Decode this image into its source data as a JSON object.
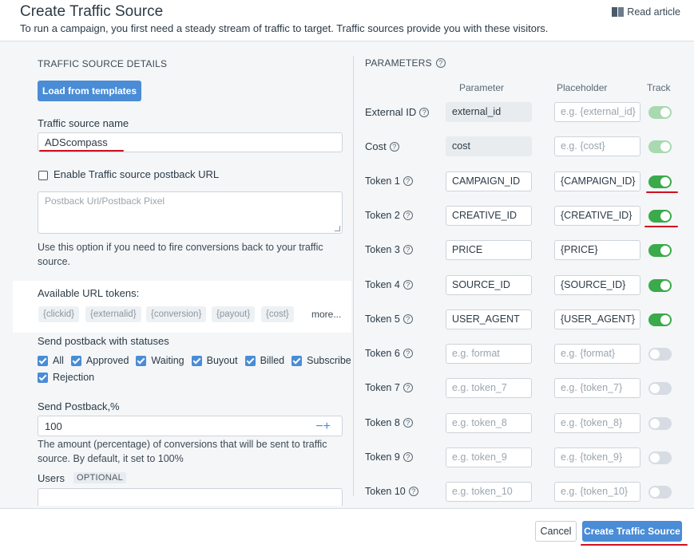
{
  "header": {
    "title": "Create Traffic Source",
    "subtitle": "To run a campaign, you first need a steady stream of traffic to target. Traffic sources provide you with these visitors.",
    "read_article": "Read article"
  },
  "left": {
    "section_title": "TRAFFIC SOURCE DETAILS",
    "load_templates": "Load from templates",
    "name_label": "Traffic source name",
    "name_value": "ADScompass",
    "postback_checkbox_label": "Enable Traffic source postback URL",
    "postback_placeholder": "Postback Url/Postback Pixel",
    "postback_help": "Use this option if you need to fire conversions back to your traffic source.",
    "tokens_title": "Available URL tokens:",
    "tokens": [
      "{clickid}",
      "{externalid}",
      "{conversion}",
      "{payout}",
      "{cost}"
    ],
    "tokens_more": "more...",
    "statuses_title": "Send postback with statuses",
    "statuses": [
      "All",
      "Approved",
      "Waiting",
      "Buyout",
      "Billed",
      "Subscribe",
      "Rejection"
    ],
    "send_postback_label": "Send Postback,%",
    "send_postback_value": "100",
    "send_postback_help": "The amount (percentage) of conversions that will be sent to traffic source. By default, it set to 100%",
    "users_label": "Users",
    "users_badge": "OPTIONAL"
  },
  "right": {
    "section_title": "PARAMETERS",
    "col_parameter": "Parameter",
    "col_placeholder": "Placeholder",
    "col_track": "Track",
    "rows": [
      {
        "label": "External ID",
        "param": "external_id",
        "placeholder": "e.g. {external_id}",
        "track": true
      },
      {
        "label": "Cost",
        "param": "cost",
        "placeholder": "e.g. {cost}",
        "track": true
      },
      {
        "label": "Token 1",
        "param": "CAMPAIGN_ID",
        "placeholder": "{CAMPAIGN_ID}",
        "track": true
      },
      {
        "label": "Token 2",
        "param": "CREATIVE_ID",
        "placeholder": "{CREATIVE_ID}",
        "track": true
      },
      {
        "label": "Token 3",
        "param": "PRICE",
        "placeholder": "{PRICE}",
        "track": true
      },
      {
        "label": "Token 4",
        "param": "SOURCE_ID",
        "placeholder": "{SOURCE_ID}",
        "track": true
      },
      {
        "label": "Token 5",
        "param": "USER_AGENT",
        "placeholder": "{USER_AGENT}",
        "track": true
      },
      {
        "label": "Token 6",
        "param": "e.g. format",
        "placeholder": "e.g. {format}",
        "track": false
      },
      {
        "label": "Token 7",
        "param": "e.g. token_7",
        "placeholder": "e.g. {token_7}",
        "track": false
      },
      {
        "label": "Token 8",
        "param": "e.g. token_8",
        "placeholder": "e.g. {token_8}",
        "track": false
      },
      {
        "label": "Token 9",
        "param": "e.g. token_9",
        "placeholder": "e.g. {token_9}",
        "track": false
      },
      {
        "label": "Token 10",
        "param": "e.g. token_10",
        "placeholder": "e.g. {token_10}",
        "track": false
      }
    ]
  },
  "footer": {
    "cancel": "Cancel",
    "create": "Create Traffic Source"
  },
  "colors": {
    "accent": "#4a8cd6",
    "toggle_on": "#3aaa4a",
    "annotation_red": "#d01020"
  }
}
